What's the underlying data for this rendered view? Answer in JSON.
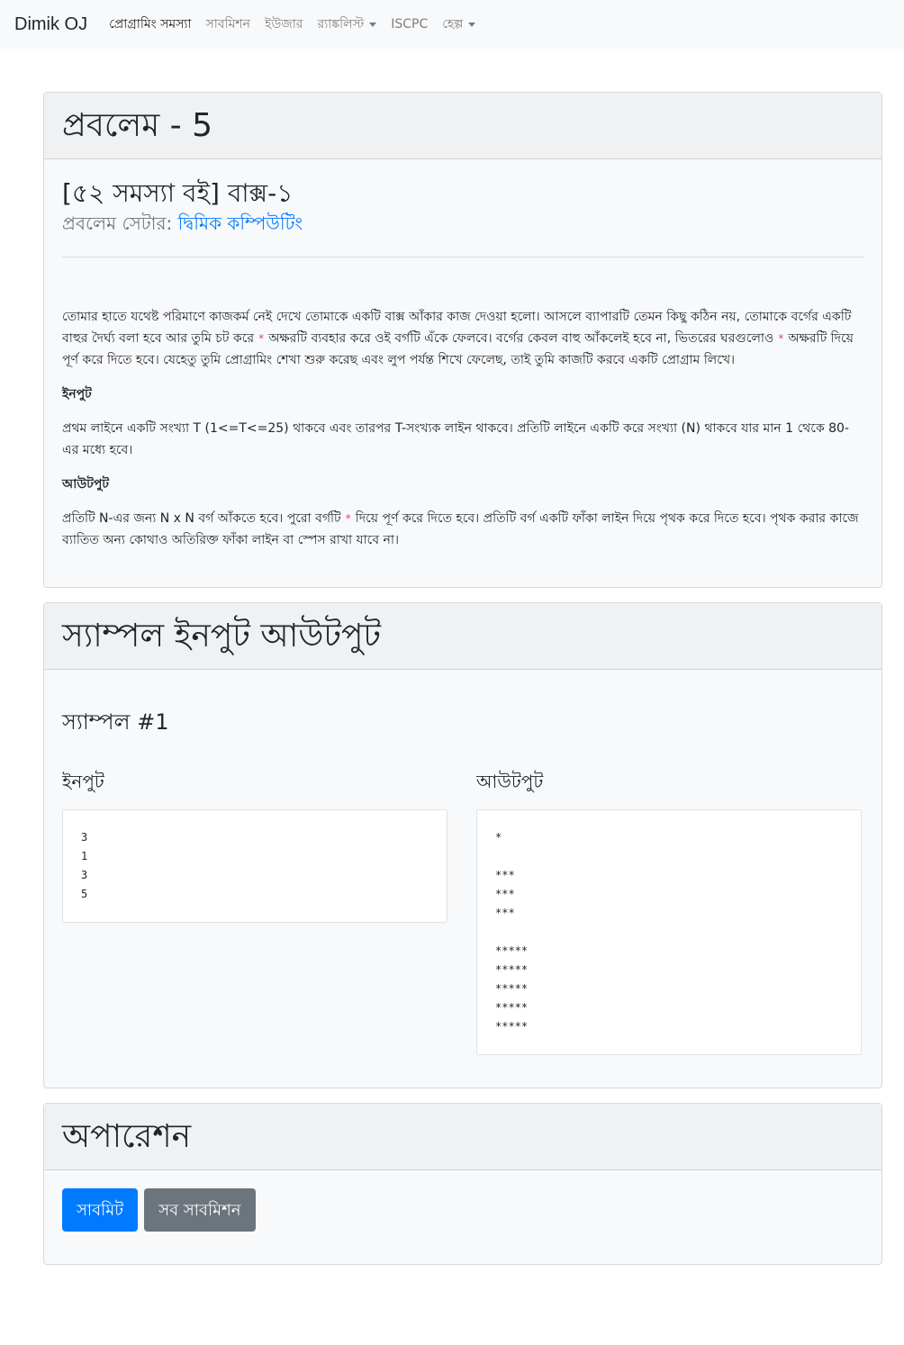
{
  "navbar": {
    "brand": "Dimik OJ",
    "items": [
      {
        "label": "প্রোগ্রামিং সমস্যা",
        "active": true,
        "dropdown": false
      },
      {
        "label": "সাবমিশন",
        "active": false,
        "dropdown": false
      },
      {
        "label": "ইউজার",
        "active": false,
        "dropdown": false
      },
      {
        "label": "র‍্যাঙ্কলিস্ট",
        "active": false,
        "dropdown": true
      },
      {
        "label": "ISCPC",
        "active": false,
        "dropdown": false
      },
      {
        "label": "হেল্প",
        "active": false,
        "dropdown": true
      }
    ]
  },
  "problem": {
    "header": "প্রবলেম - 5",
    "title": "[৫২ সমস্যা বই] বাক্স-১",
    "setter_label": "প্রবলেম সেটার:",
    "setter_name": "দ্বিমিক কম্পিউটিং",
    "desc_1": "তোমার হাতে যথেষ্ট পরিমাণে কাজকর্ম নেই দেখে তোমাকে একটি বাক্স আঁকার কাজ দেওয়া হলো। আসলে ব্যাপারটি তেমন কিছু কঠিন নয়, তোমাকে বর্গের একটি বাহুর দৈর্ঘ্য বলা হবে আর তুমি চট করে",
    "star": "*",
    "desc_2": "অক্ষরটি ব্যবহার করে ওই বর্গটি এঁকে ফেলবে। বর্গের কেবল বাহু আঁকলেই হবে না, ভিতরের ঘরগুলোও",
    "desc_3": "অক্ষরটি দিয়ে পূর্ণ করে দিতে হবে। যেহেতু তুমি প্রোগ্রামিং শেখা শুরু করেছ এবং লুপ পর্যন্ত শিখে ফেলেছ, তাই তুমি কাজটি করবে একটি প্রোগ্রাম লিখে।",
    "input_heading": "ইনপুট",
    "input_text": "প্রথম লাইনে একটি সংখ্যা T (1<=T<=25) থাকবে এবং তারপর T-সংখ্যক লাইন থাকবে। প্রতিটি লাইনে একটি করে সংখ্যা (N) থাকবে যার মান 1 থেকে 80-এর মধ্যে হবে।",
    "output_heading": "আউটপুট",
    "output_text_1": "প্রতিটি N-এর জন্য N x N বর্গ আঁকতে হবে। পুরো বর্গটি",
    "output_text_2": "দিয়ে পূর্ণ করে দিতে হবে। প্রতিটি বর্গ একটি ফাঁকা লাইন দিয়ে পৃথক করে দিতে হবে। পৃথক করার কাজে ব্যাতিত অন্য কোথাও অতিরিক্ত ফাঁকা লাইন বা স্পেস রাখা যাবে না।"
  },
  "samples": {
    "header": "স্যাম্পল ইনপুট আউটপুট",
    "sample_title": "স্যাম্পল #1",
    "input_label": "ইনপুট",
    "output_label": "আউটপুট",
    "input_text": "3\n1\n3\n5",
    "output_text": "*\n\n***\n***\n***\n\n*****\n*****\n*****\n*****\n*****"
  },
  "operation": {
    "header": "অপারেশন",
    "submit_label": "সাবমিট",
    "all_submissions_label": "সব সাবমিশন"
  }
}
